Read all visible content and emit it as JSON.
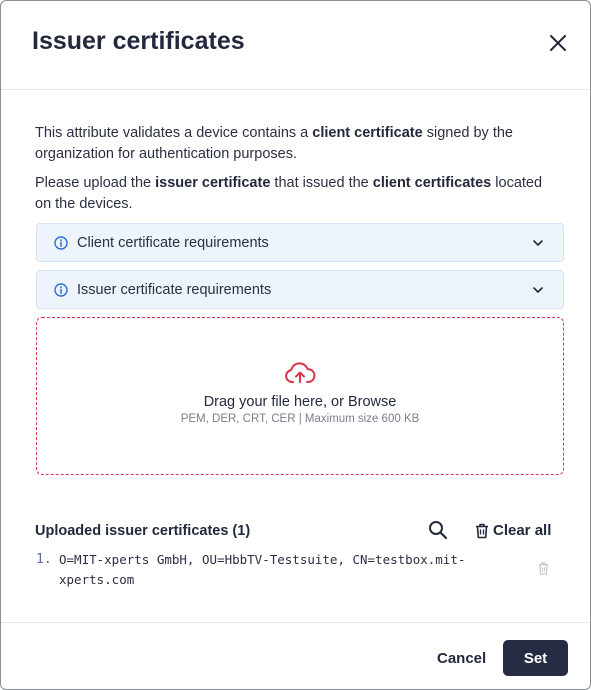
{
  "dialog": {
    "title": "Issuer certificates"
  },
  "description": {
    "p1": [
      {
        "text": "This attribute validates a device contains a ",
        "bold": false
      },
      {
        "text": "client certificate",
        "bold": true
      },
      {
        "text": " signed by the organization for authentication purposes.",
        "bold": false
      }
    ],
    "p2": [
      {
        "text": "Please upload the ",
        "bold": false
      },
      {
        "text": "issuer certificate",
        "bold": true
      },
      {
        "text": " that issued the ",
        "bold": false
      },
      {
        "text": "client certificates",
        "bold": true
      },
      {
        "text": " located on the devices.",
        "bold": false
      }
    ]
  },
  "accordions": [
    {
      "label": "Client certificate requirements"
    },
    {
      "label": "Issuer certificate requirements"
    }
  ],
  "dropzone": {
    "main": "Drag your file here, or Browse",
    "sub": "PEM, DER, CRT, CER | Maximum size 600 KB"
  },
  "uploaded": {
    "title": "Uploaded issuer certificates (1)",
    "clear_all_label": "Clear all",
    "items": [
      {
        "number": "1.",
        "text": "O=MIT-xperts GmbH, OU=HbbTV-Testsuite, CN=testbox.mit-xperts.com"
      }
    ]
  },
  "footer": {
    "cancel_label": "Cancel",
    "set_label": "Set"
  },
  "colors": {
    "primary_dark": "#262c44",
    "info_blue": "#2b6fd6",
    "accordion_bg": "#eef4fc",
    "accent_red": "#d9364a"
  },
  "icons": {
    "close": "close-icon",
    "info": "info-icon",
    "chevron": "chevron-down-icon",
    "upload": "cloud-upload-icon",
    "search": "search-icon",
    "trash": "trash-icon"
  }
}
